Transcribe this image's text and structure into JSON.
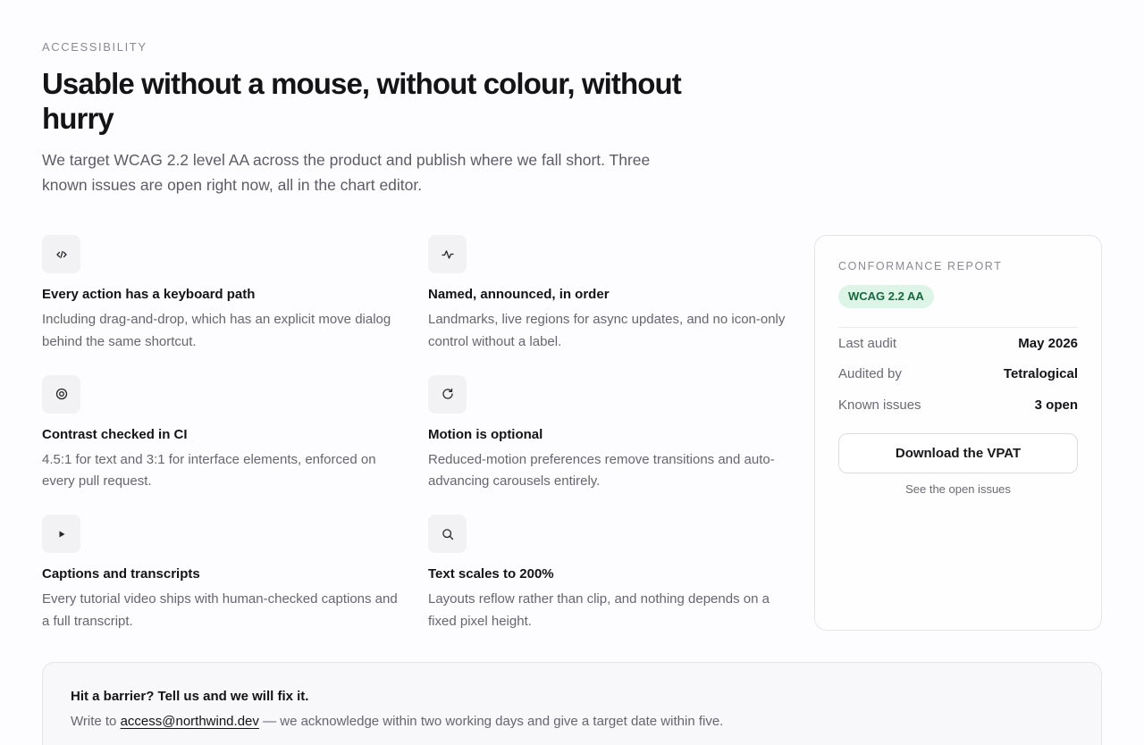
{
  "header": {
    "eyebrow": "ACCESSIBILITY",
    "title": "Usable without a mouse, without colour, without hurry",
    "lede": "We target WCAG 2.2 level AA across the product and publish where we fall short. Three known issues are open right now, all in the chart editor."
  },
  "features": [
    {
      "icon": "code-icon",
      "title": "Every action has a keyboard path",
      "body": "Including drag-and-drop, which has an explicit move dialog behind the same shortcut."
    },
    {
      "icon": "pulse-icon",
      "title": "Named, announced, in order",
      "body": "Landmarks, live regions for async updates, and no icon-only control without a label."
    },
    {
      "icon": "target-icon",
      "title": "Contrast checked in CI",
      "body": "4.5:1 for text and 3:1 for interface elements, enforced on every pull request."
    },
    {
      "icon": "refresh-icon",
      "title": "Motion is optional",
      "body": "Reduced-motion preferences remove transitions and auto-advancing carousels entirely."
    },
    {
      "icon": "play-icon",
      "title": "Captions and transcripts",
      "body": "Every tutorial video ships with human-checked captions and a full transcript."
    },
    {
      "icon": "search-icon",
      "title": "Text scales to 200%",
      "body": "Layouts reflow rather than clip, and nothing depends on a fixed pixel height."
    }
  ],
  "report": {
    "eyebrow": "CONFORMANCE REPORT",
    "badge": "WCAG 2.2 AA",
    "rows": [
      {
        "label": "Last audit",
        "value": "May 2026"
      },
      {
        "label": "Audited by",
        "value": "Tetralogical"
      },
      {
        "label": "Known issues",
        "value": "3 open"
      }
    ],
    "download_label": "Download the VPAT",
    "issues_link": "See the open issues"
  },
  "barrier": {
    "title": "Hit a barrier? Tell us and we will fix it.",
    "prefix": "Write to",
    "email": "access@northwind.dev",
    "suffix": "— we acknowledge within two working days and give a target date within five."
  },
  "colors": {
    "badge_bg": "#dcf5e7",
    "badge_text": "#17683e",
    "text_primary": "#141417",
    "text_muted": "#66666f"
  }
}
